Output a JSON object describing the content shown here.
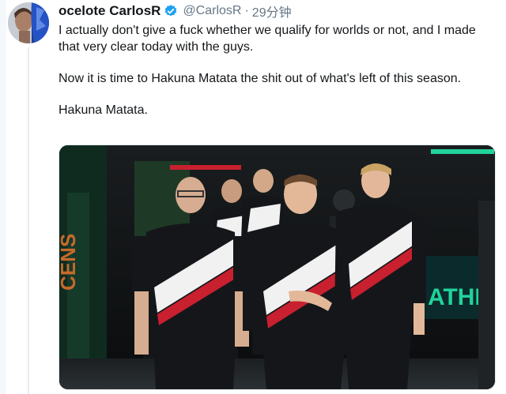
{
  "tweet": {
    "display_name": "ocelote CarlosR",
    "handle": "@CarlosR",
    "separator": "·",
    "timestamp": "29分钟",
    "verified_icon": "verified-badge-icon",
    "text": [
      "I actually don't give a fuck whether we qualify for worlds or not, and I made that very clear today with the guys.",
      "Now it is time to Hakuna Matata the shit out of what's left of this season.",
      "Hakuna Matata."
    ],
    "media": {
      "type": "photo",
      "stage_sign_left": "CENS",
      "stage_sign_right": "ATHE"
    }
  },
  "colors": {
    "verified": "#1da1f2",
    "text": "#14171a",
    "secondary": "#657786",
    "jersey_black": "#15161a",
    "jersey_white": "#f1f1f1",
    "jersey_red": "#c8202f",
    "neon_green": "#21d39a"
  }
}
